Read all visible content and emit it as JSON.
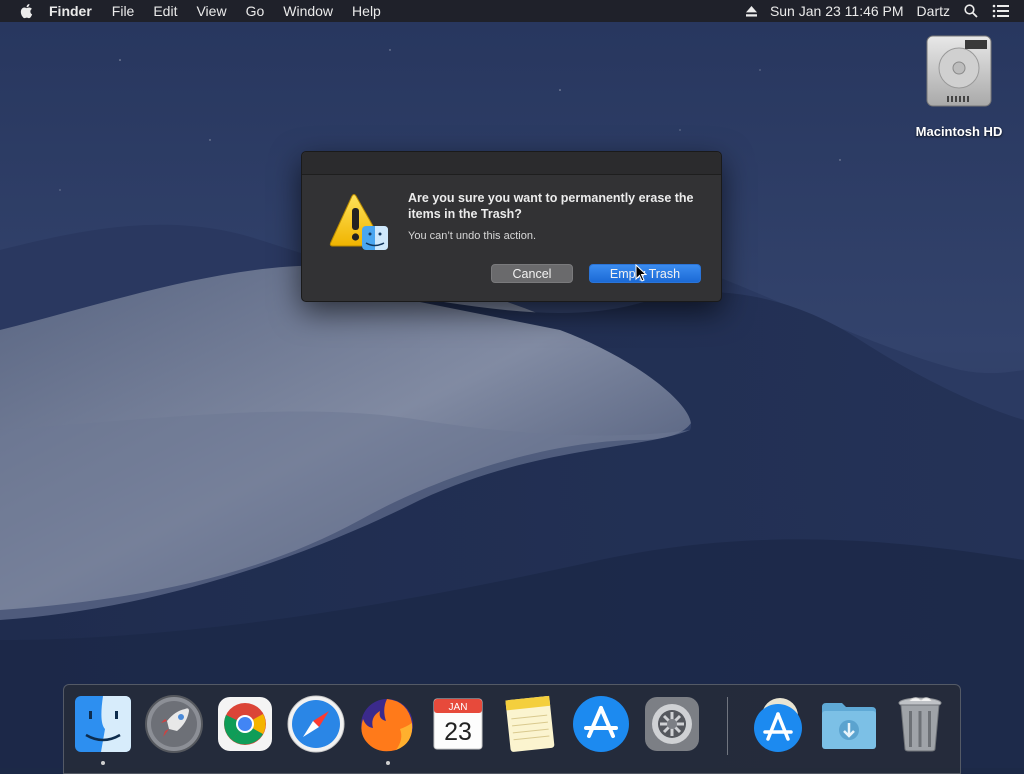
{
  "menubar": {
    "app_name": "Finder",
    "menus": [
      "File",
      "Edit",
      "View",
      "Go",
      "Window",
      "Help"
    ],
    "datetime": "Sun Jan 23  11:46 PM",
    "user": "Dartz"
  },
  "desktop": {
    "drive_label": "Macintosh HD"
  },
  "dialog": {
    "message": "Are you sure you want to permanently erase the items in the Trash?",
    "informative": "You can’t undo this action.",
    "cancel_label": "Cancel",
    "confirm_label": "Empty Trash"
  },
  "dock": {
    "calendar_month": "JAN",
    "calendar_day": "23",
    "items": [
      "finder-icon",
      "launchpad-icon",
      "chrome-icon",
      "safari-icon",
      "firefox-icon",
      "calendar-icon",
      "notes-icon",
      "app-store-icon",
      "system-preferences-icon",
      "app-store-download-icon",
      "downloads-folder-icon",
      "trash-icon"
    ]
  },
  "colors": {
    "accent": "#1b6ad6",
    "wallpaper_top": "#2a3a63",
    "wallpaper_bottom": "#1b2747"
  }
}
